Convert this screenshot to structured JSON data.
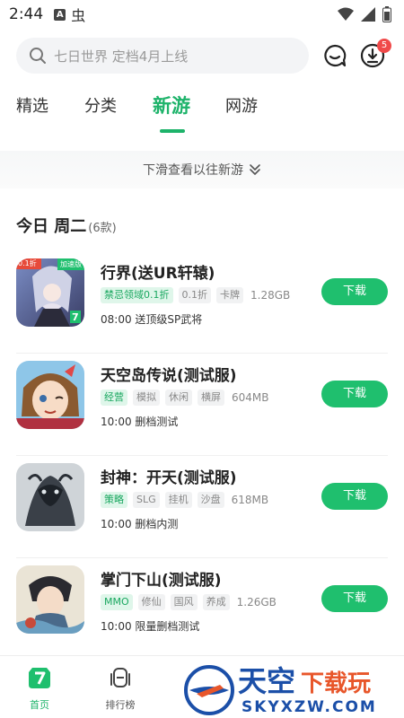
{
  "status_bar": {
    "time": "2:44",
    "a_icon_text": "A",
    "bug_char": "虫"
  },
  "search": {
    "placeholder": "七日世界  定档4月上线"
  },
  "download_badge": "5",
  "tabs": [
    {
      "label": "精选"
    },
    {
      "label": "分类"
    },
    {
      "label": "新游"
    },
    {
      "label": "网游"
    }
  ],
  "pull_hint": "下滑查看以往新游",
  "date_header": {
    "title": "今日 周二",
    "count": "(6款)"
  },
  "download_label": "下载",
  "games": [
    {
      "name": "行界(送UR轩辕)",
      "tags": [
        {
          "text": "禁忌领域0.1折",
          "hl": true
        },
        {
          "text": "0.1折",
          "hl": false
        },
        {
          "text": "卡牌",
          "hl": false
        }
      ],
      "size": "1.28GB",
      "desc": "08:00  送顶级SP武将",
      "icon_badge": "加速版",
      "icon_corner": "0.1折",
      "icon_mark": "7"
    },
    {
      "name": "天空岛传说(测试服)",
      "tags": [
        {
          "text": "经营",
          "hl": true
        },
        {
          "text": "模拟",
          "hl": false
        },
        {
          "text": "休闲",
          "hl": false
        },
        {
          "text": "横屏",
          "hl": false
        }
      ],
      "size": "604MB",
      "desc": "10:00  删档测试"
    },
    {
      "name": "封神：开天(测试服)",
      "tags": [
        {
          "text": "策略",
          "hl": true
        },
        {
          "text": "SLG",
          "hl": false
        },
        {
          "text": "挂机",
          "hl": false
        },
        {
          "text": "沙盘",
          "hl": false
        }
      ],
      "size": "618MB",
      "desc": "10:00  删档内测"
    },
    {
      "name": "掌门下山(测试服)",
      "tags": [
        {
          "text": "MMO",
          "hl": true
        },
        {
          "text": "修仙",
          "hl": false
        },
        {
          "text": "国风",
          "hl": false
        },
        {
          "text": "养成",
          "hl": false
        }
      ],
      "size": "1.26GB",
      "desc": "10:00  限量删档测试"
    }
  ],
  "bottom_nav": [
    {
      "label": "首页",
      "icon": "home-icon"
    },
    {
      "label": "排行榜",
      "icon": "ranking-icon"
    }
  ],
  "watermark": {
    "title": "天空",
    "accent": "下载玩",
    "url": "SKYXZW.COM"
  },
  "colors": {
    "accent": "#1db36a",
    "button": "#1fbf6e",
    "badge": "#f04a4a",
    "watermark_blue": "#1b4fa8",
    "watermark_red": "#e8562a"
  }
}
